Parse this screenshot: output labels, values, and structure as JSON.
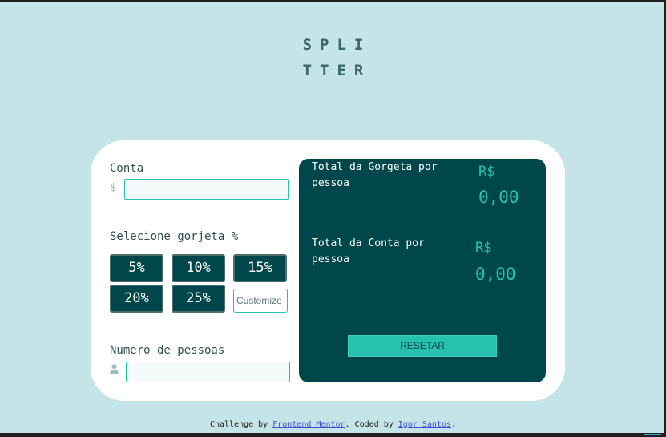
{
  "logo": {
    "line1": "SPLI",
    "line2": "TTER"
  },
  "bill": {
    "label": "Conta",
    "prefix": "$",
    "value": ""
  },
  "tip": {
    "label": "Selecione gorjeta %",
    "options": [
      "5%",
      "10%",
      "15%",
      "20%",
      "25%"
    ],
    "custom_placeholder": "Customize"
  },
  "people": {
    "label": "Numero de pessoas",
    "icon": "person-icon",
    "value": ""
  },
  "results": {
    "tip_label": "Total da Gorgeta por pessoa",
    "tip_currency": "R$",
    "tip_amount": "0,00",
    "total_label": "Total da Conta por pessoa",
    "total_currency": "R$",
    "total_amount": "0,00",
    "reset_label": "RESETAR"
  },
  "footer": {
    "prefix": "Challenge by ",
    "link1": "Frontend Mentor",
    "middle": ". Coded by ",
    "link2": "Igor Santos",
    "suffix": "."
  },
  "colors": {
    "background": "#c5e4e7",
    "dark_cyan": "#00474b",
    "strong_cyan": "#26c2ad",
    "white": "#ffffff"
  }
}
